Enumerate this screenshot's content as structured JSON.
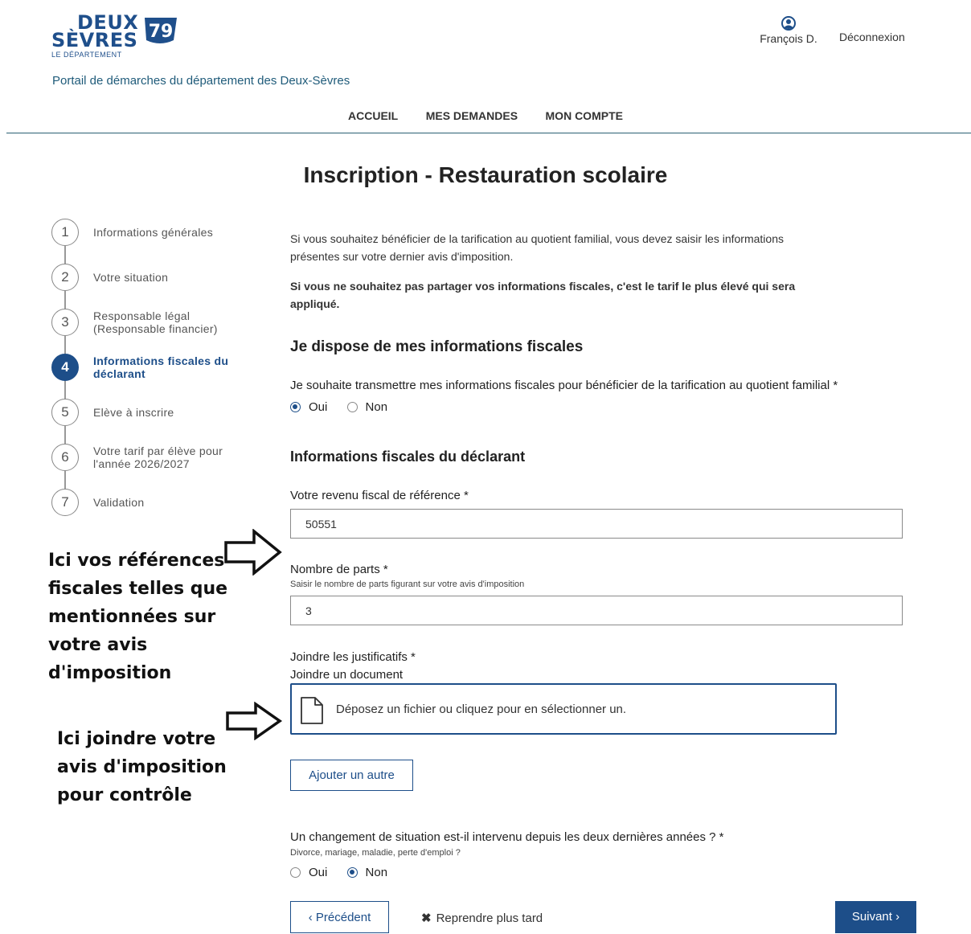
{
  "header": {
    "logo": {
      "line1": "DEUX",
      "line2": "SÈVRES",
      "line3": "LE DÉPARTEMENT",
      "badge": "79"
    },
    "user_name": "François D.",
    "logout_label": "Déconnexion",
    "portal_title": "Portail de démarches du département des Deux-Sèvres"
  },
  "nav": {
    "items": [
      "ACCUEIL",
      "MES DEMANDES",
      "MON COMPTE"
    ]
  },
  "page_title": "Inscription - Restauration scolaire",
  "stepper": {
    "active_step": 4,
    "steps": [
      {
        "num": "1",
        "label": "Informations générales"
      },
      {
        "num": "2",
        "label": "Votre situation"
      },
      {
        "num": "3",
        "label": "Responsable légal (Responsable financier)"
      },
      {
        "num": "4",
        "label": "Informations fiscales du déclarant"
      },
      {
        "num": "5",
        "label": "Elève à inscrire"
      },
      {
        "num": "6",
        "label": "Votre tarif par élève pour l'année 2026/2027"
      },
      {
        "num": "7",
        "label": "Validation"
      }
    ]
  },
  "annotations": {
    "note1": [
      "Ici vos références",
      "fiscales telles que",
      "mentionnées sur",
      "votre avis",
      "d'imposition"
    ],
    "note2": [
      "Ici joindre votre",
      "avis d'imposition",
      "pour contrôle"
    ]
  },
  "form": {
    "intro_line1": "Si vous souhaitez bénéficier de la tarification au quotient familial, vous devez saisir les informations",
    "intro_line2": "présentes sur votre dernier avis d'imposition.",
    "warning_line1": "Si vous ne souhaitez pas partager vos informations fiscales, c'est le tarif le plus élevé qui sera",
    "warning_line2": "appliqué.",
    "section1_title": "Je dispose de mes informations fiscales",
    "share_question": "Je souhaite transmettre mes informations fiscales pour bénéficier de la tarification au quotient familial *",
    "share_options": [
      "Oui",
      "Non"
    ],
    "share_selected": "Oui",
    "section2_title": "Informations fiscales du déclarant",
    "rfr_label": "Votre revenu fiscal de référence *",
    "rfr_value": "50551",
    "parts_label": "Nombre de parts *",
    "parts_hint": "Saisir le nombre de parts figurant sur votre avis d'imposition",
    "parts_value": "3",
    "attach_label": "Joindre les justificatifs *",
    "attach_sublabel": "Joindre un document",
    "dropzone_text": "Déposez un fichier ou cliquez pour en sélectionner un.",
    "add_another": "Ajouter un autre",
    "change_question": "Un changement de situation est-il intervenu depuis les deux dernières années ? *",
    "change_hint": "Divorce, mariage, maladie, perte d'emploi ?",
    "change_options": [
      "Oui",
      "Non"
    ],
    "change_selected": "Non"
  },
  "footer_buttons": {
    "previous": "‹ Précédent",
    "later": "Reprendre plus tard",
    "next": "Suivant ›"
  },
  "colors": {
    "brand_blue": "#1d4e89",
    "rule": "#2a5f73"
  }
}
